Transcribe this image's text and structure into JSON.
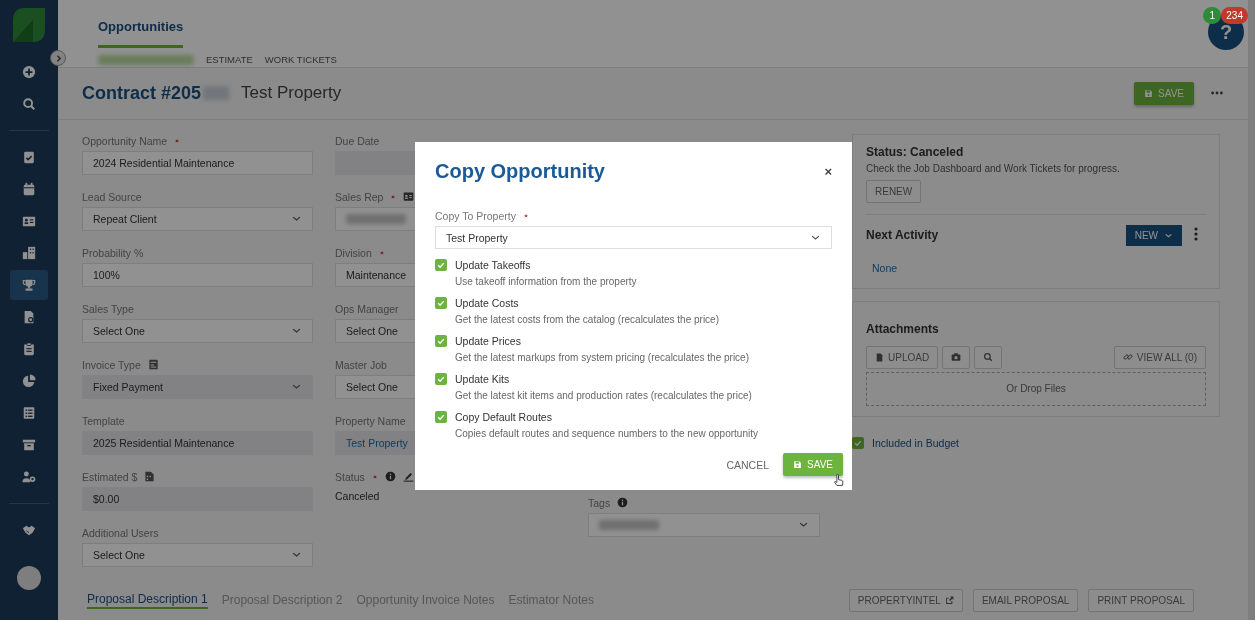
{
  "sidebar": {
    "items": [
      {
        "selected": false
      },
      {
        "selected": false
      },
      {
        "selected": false
      },
      {
        "selected": false
      },
      {
        "selected": false
      },
      {
        "selected": false
      },
      {
        "selected": true
      },
      {
        "selected": false
      },
      {
        "selected": false
      },
      {
        "selected": false
      },
      {
        "selected": false
      },
      {
        "selected": false
      },
      {
        "selected": false
      },
      {
        "selected": false
      }
    ]
  },
  "header": {
    "title": "Opportunities",
    "tabs": [
      {
        "label": "ESTIMATE",
        "selected": false
      },
      {
        "label": "WORK TICKETS",
        "selected": false
      }
    ],
    "badges": [
      {
        "text": "1",
        "color": "#2e8b3a"
      },
      {
        "text": "234",
        "color": "#c0392b"
      }
    ],
    "help": "?"
  },
  "title_bar": {
    "contract": "Contract #205",
    "property": "Test Property",
    "save": "SAVE"
  },
  "form": {
    "columns": [
      [
        {
          "label": "Opportunity Name",
          "required": true,
          "kind": "input",
          "value": "2024 Residential Maintenance"
        },
        {
          "label": "Lead Source",
          "required": false,
          "kind": "select",
          "value": "Repeat Client"
        },
        {
          "label": "Probability %",
          "required": false,
          "kind": "input",
          "value": "100%"
        },
        {
          "label": "Sales Type",
          "required": false,
          "kind": "select",
          "value": "Select One"
        },
        {
          "label": "Invoice Type",
          "required": false,
          "kind": "readonly-select",
          "value": "Fixed Payment"
        },
        {
          "label": "Template",
          "required": false,
          "kind": "readonly",
          "value": "2025 Residential Maintenance"
        },
        {
          "label": "Estimated $",
          "required": false,
          "kind": "readonly",
          "value": "$0.00"
        },
        {
          "label": "Additional Users",
          "required": false,
          "kind": "select",
          "value": "Select One"
        }
      ],
      [
        {
          "label": "Due Date",
          "required": false,
          "kind": "readonly"
        },
        {
          "label": "Sales Rep",
          "required": true,
          "kind": "select"
        },
        {
          "label": "Division",
          "required": true,
          "kind": "select",
          "value": "Maintenance"
        },
        {
          "label": "Ops Manager",
          "required": false,
          "kind": "select",
          "value": "Select One"
        },
        {
          "label": "Master Job",
          "required": false,
          "kind": "select",
          "value": "Select One"
        },
        {
          "label": "Property Name",
          "required": false,
          "kind": "link",
          "value": "Test Property"
        },
        {
          "label": "Status",
          "required": true,
          "kind": "text",
          "value": "Canceled"
        }
      ],
      [
        {
          "label": "Tags",
          "required": false,
          "kind": "select"
        }
      ]
    ]
  },
  "status_card": {
    "title": "Status: Canceled",
    "text": "Check the Job Dashboard and Work Tickets for progress.",
    "renew": "RENEW",
    "next_title": "Next Activity",
    "new": "NEW",
    "next_value": "None"
  },
  "attachments": {
    "title": "Attachments",
    "upload": "UPLOAD",
    "view_all": "VIEW ALL (0)",
    "drop": "Or Drop Files"
  },
  "budget": {
    "label": "Included in Budget",
    "checked": true
  },
  "bottom_tabs": [
    {
      "label": "Proposal Description 1",
      "selected": true
    },
    {
      "label": "Proposal Description 2",
      "selected": false
    },
    {
      "label": "Opportunity Invoice Notes",
      "selected": false
    },
    {
      "label": "Estimator Notes",
      "selected": false
    }
  ],
  "bottom_buttons": [
    {
      "label": "PROPERTYINTEL",
      "external": true
    },
    {
      "label": "EMAIL PROPOSAL",
      "external": false
    },
    {
      "label": "PRINT PROPOSAL",
      "external": false
    }
  ],
  "modal": {
    "title": "Copy Opportunity",
    "close": "×",
    "field_label": "Copy To Property",
    "field_required": true,
    "field_value": "Test Property",
    "options": [
      {
        "label": "Update Takeoffs",
        "description": "Use takeoff information from the property",
        "checked": true
      },
      {
        "label": "Update Costs",
        "description": "Get the latest costs from the catalog (recalculates the price)",
        "checked": true
      },
      {
        "label": "Update Prices",
        "description": "Get the latest markups from system pricing (recalculates the price)",
        "checked": true
      },
      {
        "label": "Update Kits",
        "description": "Get the latest kit items and production rates (recalculates the price)",
        "checked": true
      },
      {
        "label": "Copy Default Routes",
        "description": "Copies default routes and sequence numbers to the new opportunity",
        "checked": true
      }
    ],
    "cancel": "CANCEL",
    "save": "SAVE"
  }
}
